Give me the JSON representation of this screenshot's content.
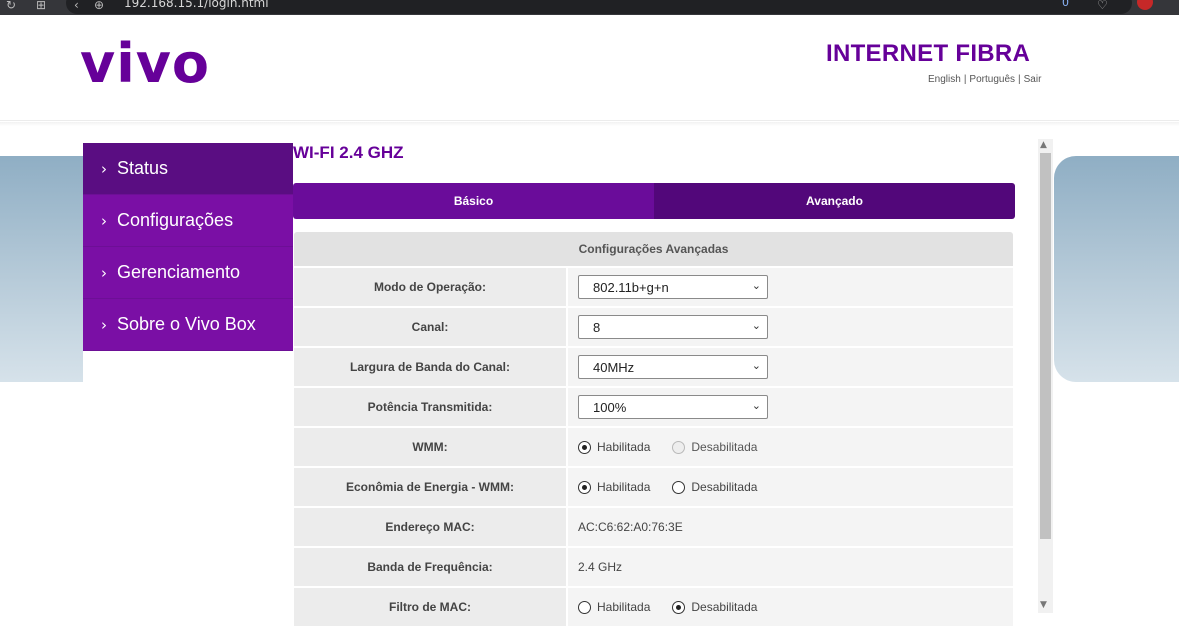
{
  "browser": {
    "url": "192.168.15.1/login.html",
    "badge": "0"
  },
  "header": {
    "logo": "vivo",
    "brand": "INTERNET FIBRA",
    "links": [
      "English",
      "Português",
      "Sair"
    ]
  },
  "sidebar": {
    "items": [
      {
        "label": "Status"
      },
      {
        "label": "Configurações"
      },
      {
        "label": "Gerenciamento"
      },
      {
        "label": "Sobre o Vivo Box"
      }
    ]
  },
  "main": {
    "title": "WI-FI 2.4 GHZ",
    "tabs": [
      {
        "label": "Básico"
      },
      {
        "label": "Avançado"
      }
    ],
    "section_title": "Configurações Avançadas",
    "rows": {
      "modo": {
        "label": "Modo de Operação:",
        "value": "802.11b+g+n"
      },
      "canal": {
        "label": "Canal:",
        "value": "8"
      },
      "largura": {
        "label": "Largura de Banda do Canal:",
        "value": "40MHz"
      },
      "potencia": {
        "label": "Potência Transmitida:",
        "value": "100%"
      },
      "wmm": {
        "label": "WMM:",
        "opt1": "Habilitada",
        "opt2": "Desabilitada"
      },
      "economia": {
        "label": "Econômia de Energia - WMM:",
        "opt1": "Habilitada",
        "opt2": "Desabilitada"
      },
      "mac": {
        "label": "Endereço MAC:",
        "value": "AC:C6:62:A0:76:3E"
      },
      "banda": {
        "label": "Banda de Frequência:",
        "value": "2.4 GHz"
      },
      "filtro": {
        "label": "Filtro de MAC:",
        "opt1": "Habilitada",
        "opt2": "Desabilitada"
      }
    }
  },
  "colors": {
    "brand": "#660099",
    "sidebar": "#7a0fa5",
    "tab_basic": "#6a0c9a",
    "tab_adv": "#52077a"
  }
}
